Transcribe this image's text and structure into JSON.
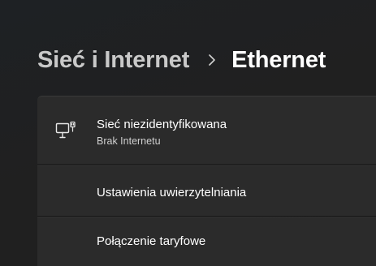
{
  "breadcrumb": {
    "parent": "Sieć i Internet",
    "current": "Ethernet"
  },
  "network": {
    "name": "Sieć niezidentyfikowana",
    "status": "Brak Internetu",
    "icon": "wired-network-icon"
  },
  "settings": {
    "auth_label": "Ustawienia uwierzytelniania",
    "metered_label": "Połączenie taryfowe"
  },
  "colors": {
    "background": "#202020",
    "card": "#2b2b2b",
    "breadcrumb_parent": "#c9c9c9",
    "text": "#ffffff",
    "secondary_text": "#cfcfcf"
  }
}
